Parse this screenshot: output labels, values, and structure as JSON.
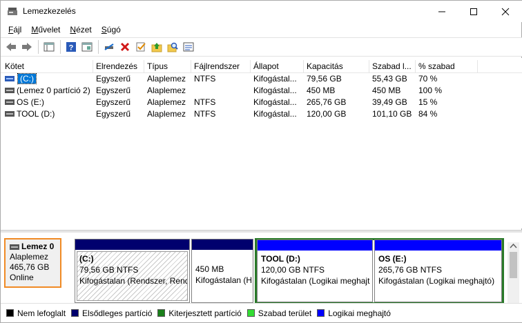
{
  "window": {
    "title": "Lemezkezelés",
    "controls": {
      "minimize": "—",
      "maximize": "☐",
      "close": "✕"
    }
  },
  "menu": [
    {
      "label": "Fájl",
      "mnemonic": "F"
    },
    {
      "label": "Művelet",
      "mnemonic": "M"
    },
    {
      "label": "Nézet",
      "mnemonic": "N"
    },
    {
      "label": "Súgó",
      "mnemonic": "S"
    }
  ],
  "toolbar": [
    "back-icon",
    "forward-icon",
    "console-tree-icon",
    "help-icon",
    "properties-view-icon",
    "connect-icon",
    "delete-icon",
    "checklist-icon",
    "open-folder-up-icon",
    "search-folder-icon",
    "list-view-icon"
  ],
  "volumes": {
    "columns": [
      "Kötet",
      "Elrendezés",
      "Típus",
      "Fájlrendszer",
      "Állapot",
      "Kapacitás",
      "Szabad l...",
      "% szabad"
    ],
    "rows": [
      [
        "(C:)",
        "Egyszerű",
        "Alaplemez",
        "NTFS",
        "Kifogástal...",
        "79,56 GB",
        "55,43 GB",
        "70 %"
      ],
      [
        "(Lemez 0 partíció 2)",
        "Egyszerű",
        "Alaplemez",
        "",
        "Kifogástal...",
        "450 MB",
        "450 MB",
        "100 %"
      ],
      [
        "OS (E:)",
        "Egyszerű",
        "Alaplemez",
        "NTFS",
        "Kifogástal...",
        "265,76 GB",
        "39,49 GB",
        "15 %"
      ],
      [
        "TOOL (D:)",
        "Egyszerű",
        "Alaplemez",
        "NTFS",
        "Kifogástal...",
        "120,00 GB",
        "101,10 GB",
        "84 %"
      ]
    ]
  },
  "disk": {
    "name": "Lemez 0",
    "type": "Alaplemez",
    "size": "465,76 GB",
    "status": "Online",
    "partitions": [
      {
        "title": "(C:)",
        "size": "79,56 GB NTFS",
        "status": "Kifogástalan (Rendszer, Rend",
        "bar_color": "#00006e"
      },
      {
        "title": "",
        "size": "450 MB",
        "status": "Kifogástalan (H",
        "bar_color": "#00006e"
      },
      {
        "title": "TOOL  (D:)",
        "size": "120,00 GB NTFS",
        "status": "Kifogástalan (Logikai meghajt",
        "bar_color": "#0000ff"
      },
      {
        "title": "OS  (E:)",
        "size": "265,76 GB NTFS",
        "status": "Kifogástalan (Logikai meghajtó)",
        "bar_color": "#0000ff"
      }
    ]
  },
  "legend": [
    {
      "label": "Nem lefoglalt",
      "color": "#000000"
    },
    {
      "label": "Elsődleges partíció",
      "color": "#00006e"
    },
    {
      "label": "Kiterjesztett partíció",
      "color": "#1a7f1a"
    },
    {
      "label": "Szabad terület",
      "color": "#33dd33"
    },
    {
      "label": "Logikai meghajtó",
      "color": "#0000ff"
    }
  ]
}
